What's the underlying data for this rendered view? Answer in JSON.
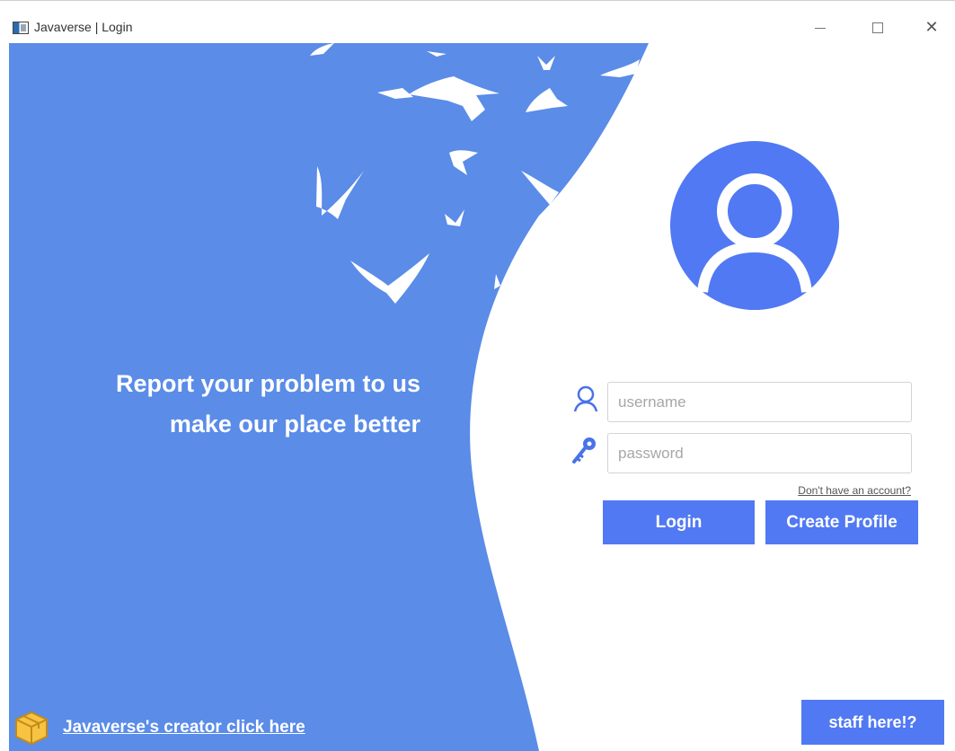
{
  "window": {
    "title": "Javaverse | Login",
    "min_glyph": "minimize",
    "max_glyph": "maximize",
    "close_glyph": "✕"
  },
  "left": {
    "tagline_line1": "Report your problem to us",
    "tagline_line2": "make our place better",
    "creator_link": "Javaverse's creator click here",
    "box_icon": "package-box-icon",
    "bg_color": "#5a8ce8"
  },
  "login": {
    "avatar_icon": "user-avatar-icon",
    "username_placeholder": "username",
    "password_placeholder": "password",
    "account_link": "Don't have an account?",
    "login_label": "Login",
    "create_label": "Create Profile",
    "staff_label": "staff here!?",
    "accent_color": "#5179f3"
  }
}
